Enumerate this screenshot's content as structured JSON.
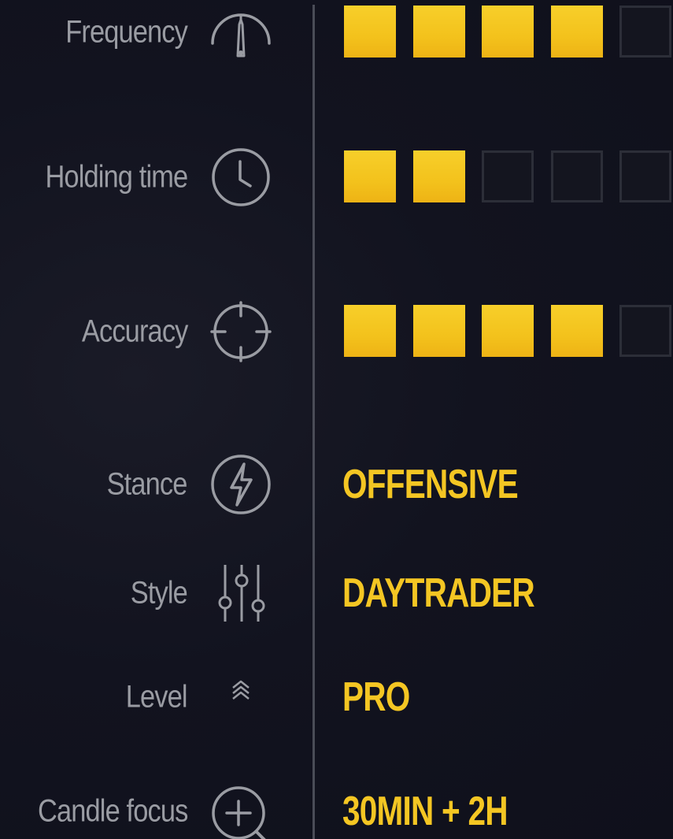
{
  "accent_color": "#f4c623",
  "stats": [
    {
      "label": "Frequency",
      "icon": "gauge-icon",
      "rating": 4,
      "max": 5
    },
    {
      "label": "Holding time",
      "icon": "clock-icon",
      "rating": 2,
      "max": 5
    },
    {
      "label": "Accuracy",
      "icon": "crosshair-icon",
      "rating": 4,
      "max": 5
    }
  ],
  "attributes": [
    {
      "label": "Stance",
      "icon": "lightning-icon",
      "value": "OFFENSIVE"
    },
    {
      "label": "Style",
      "icon": "sliders-icon",
      "value": "DAYTRADER"
    },
    {
      "label": "Level",
      "icon": "chevrons-up-icon",
      "value": "PRO"
    },
    {
      "label": "Candle focus",
      "icon": "zoom-in-icon",
      "value": "30MIN + 2H"
    }
  ]
}
